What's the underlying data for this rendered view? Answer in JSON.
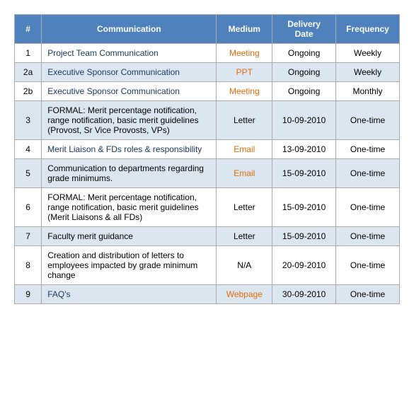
{
  "table": {
    "headers": {
      "hash": "#",
      "communication": "Communication",
      "medium": "Medium",
      "delivery_date": "Delivery Date",
      "frequency": "Frequency"
    },
    "rows": [
      {
        "id": "1",
        "communication": "Project Team Communication",
        "comm_type": "link",
        "medium": "Meeting",
        "medium_type": "orange",
        "delivery_date": "Ongoing",
        "frequency": "Weekly"
      },
      {
        "id": "2a",
        "communication": "Executive Sponsor Communication",
        "comm_type": "link",
        "medium": "PPT",
        "medium_type": "orange",
        "delivery_date": "Ongoing",
        "frequency": "Weekly"
      },
      {
        "id": "2b",
        "communication": "Executive Sponsor Communication",
        "comm_type": "link",
        "medium": "Meeting",
        "medium_type": "orange",
        "delivery_date": "Ongoing",
        "frequency": "Monthly"
      },
      {
        "id": "3",
        "communication": "FORMAL: Merit percentage notification, range notification, basic merit guidelines (Provost, Sr Vice Provosts, VPs)",
        "comm_type": "formal",
        "medium": "Letter",
        "medium_type": "black",
        "delivery_date": "10-09-2010",
        "frequency": "One-time"
      },
      {
        "id": "4",
        "communication": "Merit Liaison & FDs roles & responsibility",
        "comm_type": "link",
        "medium": "Email",
        "medium_type": "orange",
        "delivery_date": "13-09-2010",
        "frequency": "One-time"
      },
      {
        "id": "5",
        "communication": "Communication to departments regarding grade minimums.",
        "comm_type": "normal",
        "medium": "Email",
        "medium_type": "orange",
        "delivery_date": "15-09-2010",
        "frequency": "One-time"
      },
      {
        "id": "6",
        "communication": "FORMAL: Merit percentage notification, range notification, basic merit guidelines (Merit Liaisons & all FDs)",
        "comm_type": "formal",
        "medium": "Letter",
        "medium_type": "black",
        "delivery_date": "15-09-2010",
        "frequency": "One-time"
      },
      {
        "id": "7",
        "communication": "Faculty merit guidance",
        "comm_type": "normal",
        "medium": "Letter",
        "medium_type": "black",
        "delivery_date": "15-09-2010",
        "frequency": "One-time"
      },
      {
        "id": "8",
        "communication": "Creation and distribution of letters to employees impacted by grade minimum change",
        "comm_type": "normal",
        "medium": "N/A",
        "medium_type": "black",
        "delivery_date": "20-09-2010",
        "frequency": "One-time"
      },
      {
        "id": "9",
        "communication": "FAQ's",
        "comm_type": "link",
        "medium": "Webpage",
        "medium_type": "orange",
        "delivery_date": "30-09-2010",
        "frequency": "One-time"
      }
    ]
  }
}
